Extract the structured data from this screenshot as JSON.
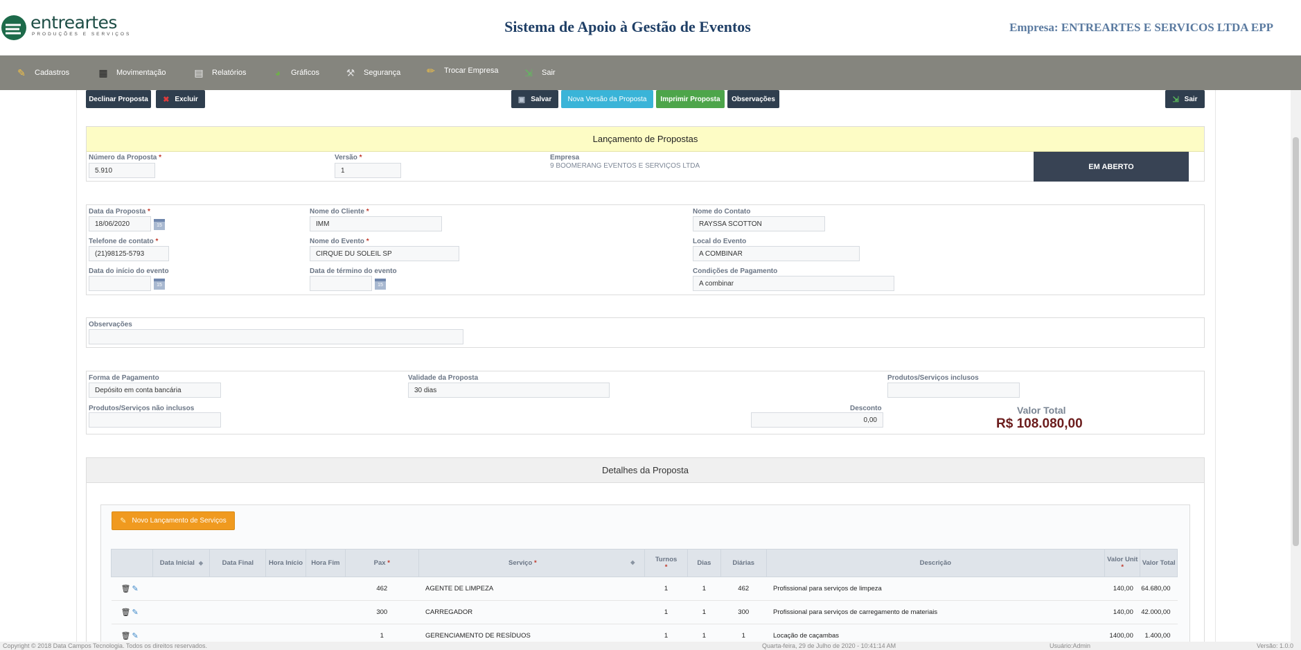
{
  "header": {
    "logo_text": "entreartes",
    "logo_sub": "PRODUÇÕES E SERVIÇOS",
    "system_title": "Sistema de Apoio à Gestão de Eventos",
    "company": "Empresa: ENTREARTES E SERVICOS LTDA EPP"
  },
  "menu": {
    "items": [
      {
        "label": "Cadastros",
        "icon": "pencil-icon"
      },
      {
        "label": "Movimentação",
        "icon": "clapperboard-icon"
      },
      {
        "label": "Relatórios",
        "icon": "document-icon"
      },
      {
        "label": "Gráficos",
        "icon": "chart-icon"
      },
      {
        "label": "Segurança",
        "icon": "hammer-icon"
      },
      {
        "label": "Trocar Empresa",
        "icon": "ruler-icon"
      },
      {
        "label": "Sair",
        "icon": "exit-icon"
      }
    ]
  },
  "toolbar": {
    "decline": "Declinar Proposta",
    "delete": "Excluir",
    "save": "Salvar",
    "new_version": "Nova Versão da Proposta",
    "print": "Imprimir Proposta",
    "notes": "Observações",
    "exit": "Sair"
  },
  "proposal": {
    "title": "Lançamento de Propostas",
    "number_label": "Número da Proposta",
    "number": "5.910",
    "version_label": "Versão",
    "version": "1",
    "company_label": "Empresa",
    "company_value": "9 BOOMERANG EVENTOS E SERVIÇOS LTDA",
    "status": "EM ABERTO"
  },
  "details": {
    "date_label": "Data da Proposta",
    "date": "18/06/2020",
    "client_label": "Nome do Cliente",
    "client": "IMM",
    "contact_label": "Nome do Contato",
    "contact": "RAYSSA SCOTTON",
    "phone_label": "Telefone de contato",
    "phone": "(21)98125-5793",
    "event_label": "Nome do Evento",
    "event": "CIRQUE DU SOLEIL SP",
    "location_label": "Local do Evento",
    "location": "A COMBINAR",
    "start_label": "Data do início do evento",
    "start": "",
    "end_label": "Data de término do evento",
    "end": "",
    "payment_cond_label": "Condições de Pagamento",
    "payment_cond": "A combinar",
    "cal_glyph": "15"
  },
  "notes": {
    "label": "Observações",
    "value": ""
  },
  "payment": {
    "form_label": "Forma de Pagamento",
    "form": "Depósito em conta bancária",
    "validity_label": "Validade da Proposta",
    "validity": "30 dias",
    "included_label": "Produtos/Serviços inclusos",
    "included": "",
    "not_included_label": "Produtos/Serviços não inclusos",
    "not_included": "",
    "discount_label": "Desconto",
    "discount": "0,00",
    "total_label": "Valor Total",
    "total": "R$ 108.080,00"
  },
  "services": {
    "section_title": "Detalhes da Proposta",
    "new_button": "Novo Lançamento de Serviços",
    "columns": [
      "",
      "Data Inicial",
      "Data Final",
      "Hora Início",
      "Hora Fim",
      "Pax",
      "Serviço",
      "Turnos",
      "Dias",
      "Diárias",
      "Descrição",
      "Valor Unit",
      "Valor Total"
    ],
    "rows": [
      {
        "pax": "462",
        "service": "AGENTE DE LIMPEZA",
        "turns": "1",
        "days": "1",
        "daily": "462",
        "desc": "Profissional para serviços de limpeza",
        "unit": "140,00",
        "total": "64.680,00"
      },
      {
        "pax": "300",
        "service": "CARREGADOR",
        "turns": "1",
        "days": "1",
        "daily": "300",
        "desc": "Profissional para serviços de carregamento de materiais",
        "unit": "140,00",
        "total": "42.000,00"
      },
      {
        "pax": "1",
        "service": "GERENCIAMENTO DE RESÍDUOS",
        "turns": "1",
        "days": "1",
        "daily": "1",
        "desc": "Locação de caçambas",
        "unit": "1400,00",
        "total": "1.400,00"
      }
    ]
  },
  "footer": {
    "copyright": "Copyright © 2018 Data Campos Tecnologia. Todos os direitos reservados.",
    "datetime": "Quarta-feira, 29 de Julho de 2020 - 10:41:14 AM",
    "user": "Usuário:Admin",
    "version": "Versão: 1.0.0"
  },
  "colors": {
    "menubar": "#85857e",
    "title": "#1f3f66",
    "status_bg": "#384354",
    "total": "#6b1c1c",
    "accent_orange": "#f09a1f",
    "accent_teal": "#3ab4d8",
    "accent_green": "#4da54a"
  }
}
